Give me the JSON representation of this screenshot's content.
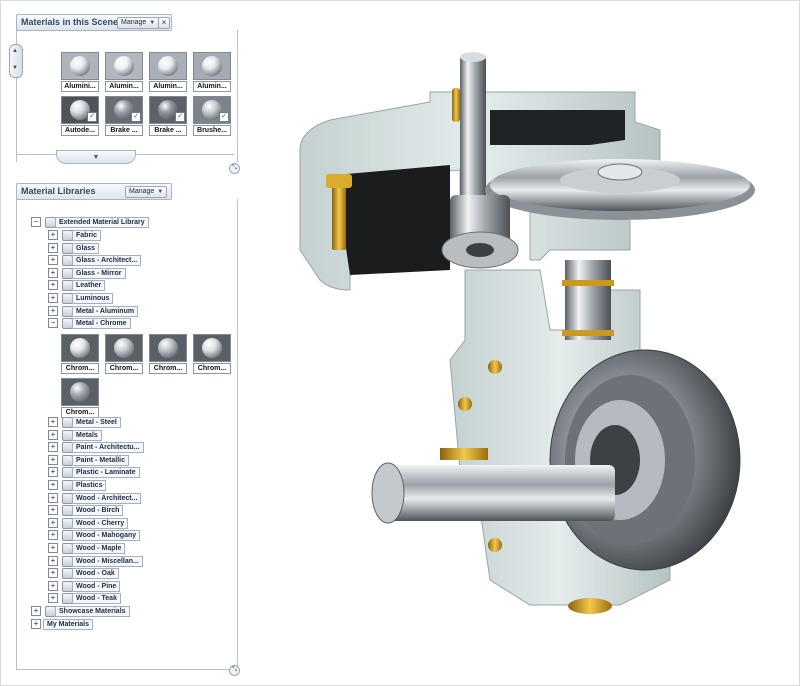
{
  "scene_panel": {
    "title": "Materials in this Scene",
    "manage_label": "Manage",
    "close_glyph": "×",
    "swatches_row1": [
      {
        "label": "Alumini...",
        "color": "#aeb4ba",
        "ball": "#e7ecf0"
      },
      {
        "label": "Alumin...",
        "color": "#b3b8be",
        "ball": "#edf0f3"
      },
      {
        "label": "Alumin...",
        "color": "#aab0b7",
        "ball": "#e9edf1"
      },
      {
        "label": "Alumin...",
        "color": "#a5abb2",
        "ball": "#e4e8ec"
      }
    ],
    "swatches_row2": [
      {
        "label": "Autode...",
        "color": "#4f5358",
        "ball": "#d9dde2"
      },
      {
        "label": "Brake ...",
        "color": "#6a6e74",
        "ball": "#9aa0a7"
      },
      {
        "label": "Brake ...",
        "color": "#5e6268",
        "ball": "#8f959c"
      },
      {
        "label": "Brushe...",
        "color": "#7e848b",
        "ball": "#c9ced4"
      }
    ]
  },
  "library_panel": {
    "title": "Material Libraries",
    "manage_label": "Manage",
    "root": "Extended Material Library",
    "items_before": [
      "Fabric",
      "Glass",
      "Glass - Architect...",
      "Glass - Mirror",
      "Leather",
      "Luminous",
      "Metal - Aluminum"
    ],
    "expanded": "Metal - Chrome",
    "chrome_swatches": [
      "Chrom...",
      "Chrom...",
      "Chrom...",
      "Chrom...",
      "Chrom..."
    ],
    "items_after": [
      "Metal - Steel",
      "Metals",
      "Paint - Architectu...",
      "Paint - Metallic",
      "Plastic - Laminate",
      "Plastics",
      "Wood - Architect...",
      "Wood - Birch",
      "Wood - Cherry",
      "Wood - Mahogany",
      "Wood - Maple",
      "Wood - Miscellan...",
      "Wood - Oak",
      "Wood - Pine",
      "Wood - Teak"
    ],
    "other_libraries": [
      "Showcase Materials",
      "My Materials"
    ]
  },
  "colors": {
    "housing": "#dde7e6",
    "housing_dark": "#b9c6c5",
    "steel_light": "#e6e9ec",
    "steel_dark": "#55595e",
    "brass": "#d7a41e"
  },
  "icons": [
    "close-icon",
    "chevron-down-icon",
    "library-icon",
    "expand-icon",
    "collapse-icon",
    "resize-grip-icon",
    "scroll-up-icon",
    "scroll-down-icon"
  ]
}
